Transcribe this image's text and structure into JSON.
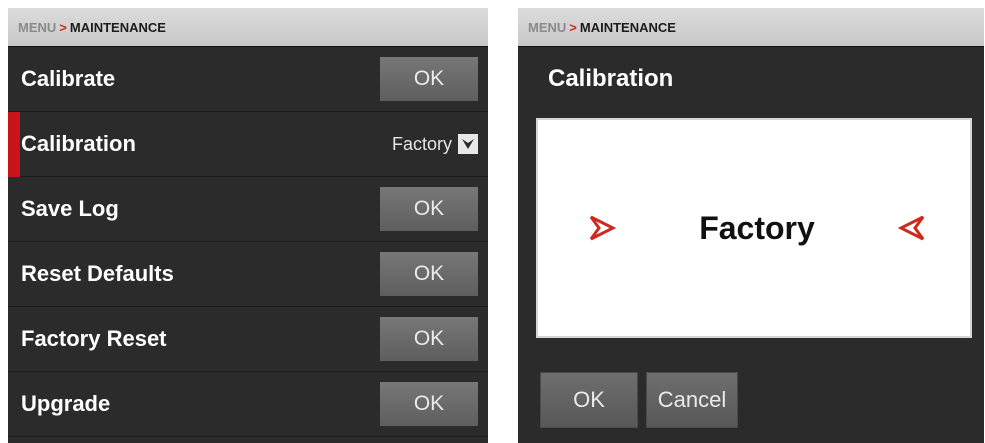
{
  "left": {
    "breadcrumb": {
      "menu": "MENU",
      "separator": ">",
      "current": "MAINTENANCE"
    },
    "rows": [
      {
        "label": "Calibrate",
        "button": "OK"
      },
      {
        "label": "Calibration",
        "value": "Factory"
      },
      {
        "label": "Save Log",
        "button": "OK"
      },
      {
        "label": "Reset Defaults",
        "button": "OK"
      },
      {
        "label": "Factory Reset",
        "button": "OK"
      },
      {
        "label": "Upgrade",
        "button": "OK"
      }
    ]
  },
  "right": {
    "breadcrumb": {
      "menu": "MENU",
      "separator": ">",
      "current": "MAINTENANCE"
    },
    "dialog_title": "Calibration",
    "picker_value": "Factory",
    "buttons": {
      "ok": "OK",
      "cancel": "Cancel"
    }
  },
  "colors": {
    "accent_red": "#c8141b",
    "panel_bg": "#2b2b2b",
    "button_gray": "#6a6a6a"
  },
  "icons": {
    "left_arrow": "arrow-right-icon",
    "right_arrow": "arrow-left-icon",
    "dropdown": "chevron-down-icon"
  }
}
